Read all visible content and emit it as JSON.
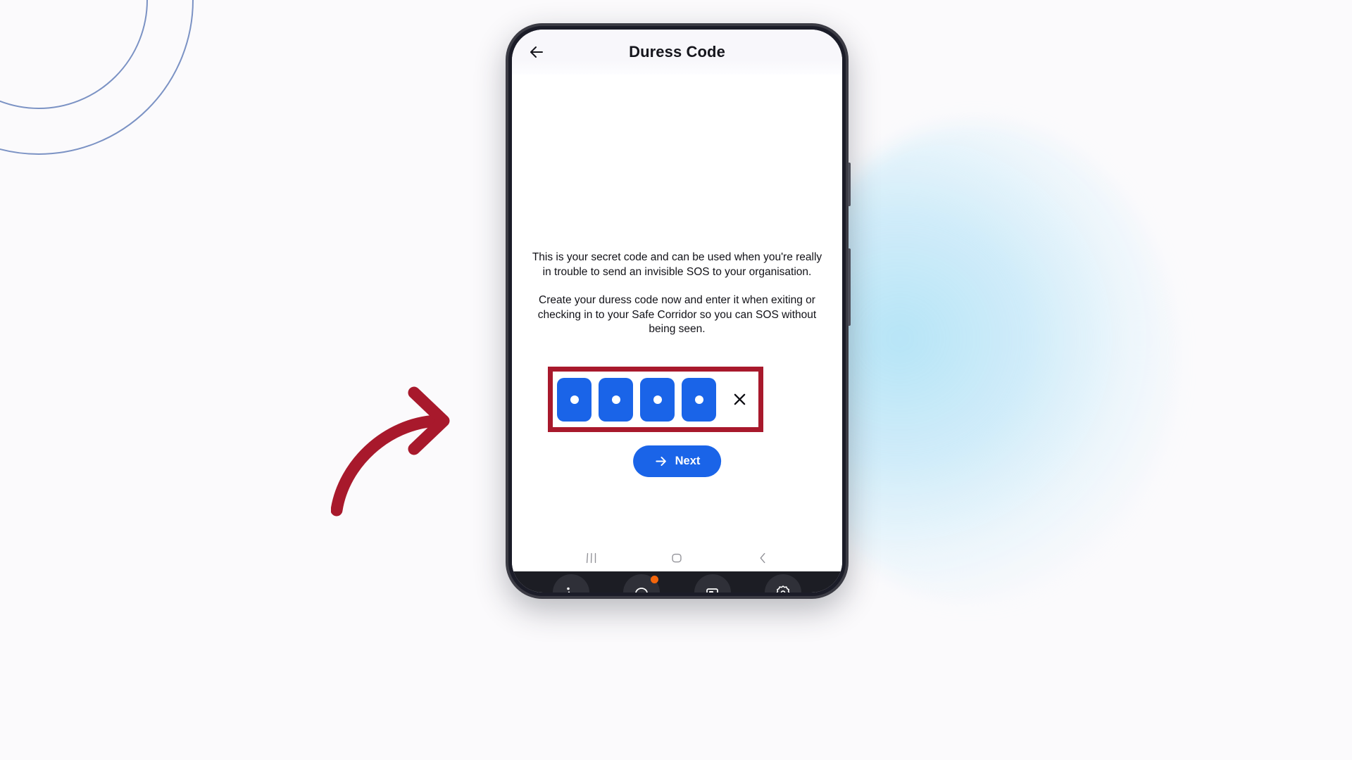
{
  "app": {
    "title": "Duress Code",
    "back_icon": "arrow-left-icon"
  },
  "content": {
    "paragraph_1": "This is your secret code and can be used when you're really in trouble to send an invisible SOS to your organisation.",
    "paragraph_2": "Create your duress code now and enter it when exiting or checking in to your Safe Corridor so you can SOS without being seen."
  },
  "pin_input": {
    "cells": [
      {
        "filled": true,
        "value": "•"
      },
      {
        "filled": true,
        "value": "•"
      },
      {
        "filled": true,
        "value": "•"
      },
      {
        "filled": true,
        "value": "•"
      }
    ],
    "clear_icon": "close-x-icon",
    "highlight_color": "#a8192c",
    "cell_color": "#1a64e8"
  },
  "next_button": {
    "label": "Next",
    "icon": "arrow-right-icon",
    "color": "#1a64e8"
  },
  "system_nav": {
    "recents_icon": "recents-icon",
    "home_icon": "home-icon",
    "back_icon": "back-chevron-icon"
  },
  "dock": {
    "apps": [
      {
        "icon": "gallery-icon",
        "badge": false
      },
      {
        "icon": "chat-icon",
        "badge": true
      },
      {
        "icon": "wallet-icon",
        "badge": false
      },
      {
        "icon": "settings-icon",
        "badge": false
      }
    ],
    "badge_color": "#f4660c"
  },
  "annotation": {
    "arrow_icon": "curved-arrow-icon",
    "color": "#a8192c"
  },
  "background": {
    "ring_color": "#7b92c4",
    "glow_color": "#b2e3f6",
    "page_color": "#fbfafc"
  }
}
